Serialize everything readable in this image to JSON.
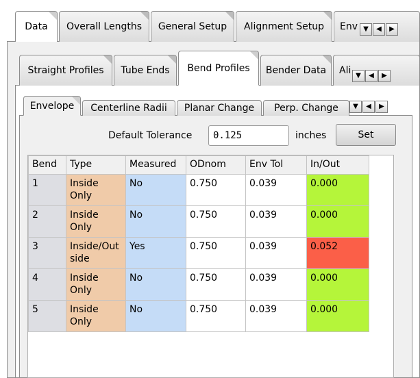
{
  "level1_tabs": [
    "Data",
    "Overall Lengths",
    "General Setup",
    "Alignment Setup",
    "Env"
  ],
  "level2_tabs": [
    "Straight Profiles",
    "Tube Ends",
    "Bend Profiles",
    "Bender Data",
    "Ali"
  ],
  "level3_tabs": [
    "Envelope",
    "Centerline Radii",
    "Planar Change",
    "Perp. Change"
  ],
  "scroll_icons": [
    "dropdown-arrow-icon",
    "scroll-left-icon",
    "scroll-right-icon"
  ],
  "tolerance": {
    "label": "Default Tolerance",
    "value": "0.125",
    "unit": "inches",
    "set_label": "Set"
  },
  "table": {
    "columns": [
      "Bend",
      "Type",
      "Measured",
      "ODnom",
      "Env Tol",
      "In/Out"
    ],
    "rows": [
      {
        "bend": "1",
        "type": "Inside Only",
        "measured": "No",
        "odnom": "0.750",
        "env_tol": "0.039",
        "in_out": "0.000",
        "status": "in"
      },
      {
        "bend": "2",
        "type": "Inside Only",
        "measured": "No",
        "odnom": "0.750",
        "env_tol": "0.039",
        "in_out": "0.000",
        "status": "in"
      },
      {
        "bend": "3",
        "type": "Inside/Outside",
        "measured": "Yes",
        "odnom": "0.750",
        "env_tol": "0.039",
        "in_out": "0.052",
        "status": "out"
      },
      {
        "bend": "4",
        "type": "Inside Only",
        "measured": "No",
        "odnom": "0.750",
        "env_tol": "0.039",
        "in_out": "0.000",
        "status": "in"
      },
      {
        "bend": "5",
        "type": "Inside Only",
        "measured": "No",
        "odnom": "0.750",
        "env_tol": "0.039",
        "in_out": "0.000",
        "status": "in"
      }
    ]
  },
  "colors": {
    "type_cell": "#f0cba9",
    "measured_cell": "#c5dcf7",
    "bend_cell": "#dddee3",
    "in_ok": "#b5f53a",
    "out_fail": "#fb5f48"
  }
}
